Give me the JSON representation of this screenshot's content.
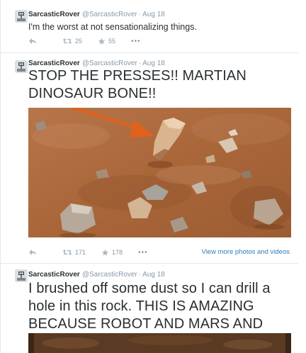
{
  "tweets": [
    {
      "name": "SarcasticRover",
      "handle": "@SarcasticRover",
      "separator": "·",
      "time": "Aug 18",
      "text": "I'm the worst at not sensationalizing things.",
      "retweets": "25",
      "favorites": "55"
    },
    {
      "name": "SarcasticRover",
      "handle": "@SarcasticRover",
      "separator": "·",
      "time": "Aug 18",
      "text": "STOP THE PRESSES!! MARTIAN DINOSAUR BONE!!",
      "retweets": "171",
      "favorites": "178",
      "media_link": "View more photos and videos"
    },
    {
      "name": "SarcasticRover",
      "handle": "@SarcasticRover",
      "separator": "·",
      "time": "Aug 18",
      "text": "I brushed off some dust so I can drill a hole in this rock. THIS IS AMAZING BECAUSE ROBOT AND MARS AND ALLCAPS!"
    }
  ],
  "icons": {
    "reply": "reply-icon",
    "retweet": "retweet-icon",
    "favorite": "star-icon",
    "more": "more-icon"
  },
  "more_glyph": "•••",
  "colors": {
    "name": "#292f33",
    "meta": "#8899a6",
    "link": "#2b7bb9",
    "mars_ground": "#b06e42",
    "arrow": "#e0621c"
  }
}
